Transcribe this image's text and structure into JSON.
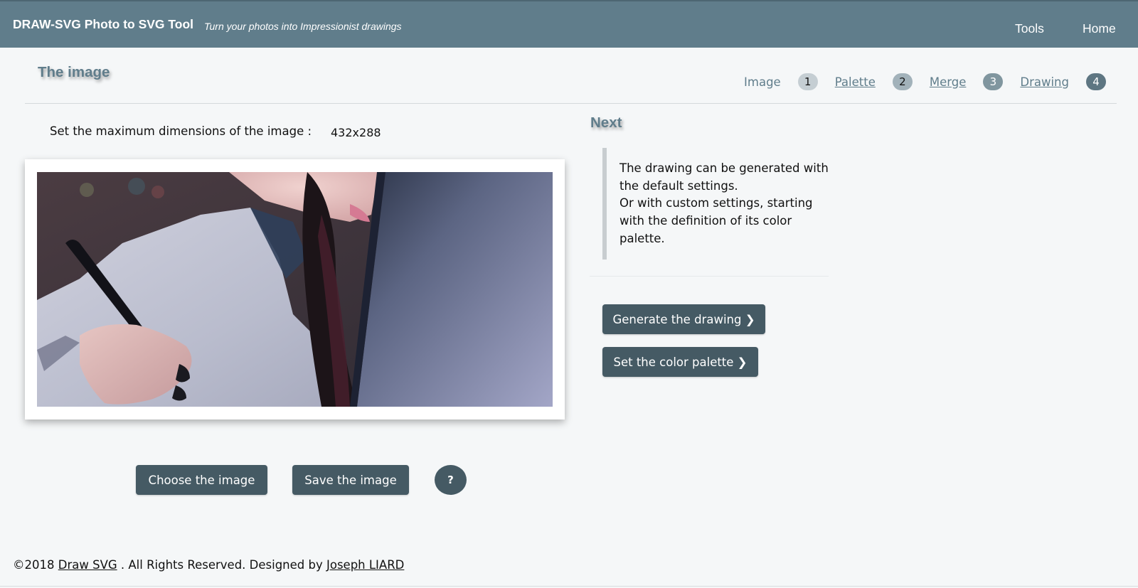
{
  "header": {
    "brand": "DRAW-SVG Photo to SVG Tool",
    "tagline": "Turn your photos into Impressionist drawings",
    "nav": [
      "Tools",
      "Home"
    ]
  },
  "image_section": {
    "title": "The image",
    "dimensions_label": "Set the maximum dimensions of the image :",
    "dimensions_value": "432x288",
    "photo_alt": "Photo of a woman drawing on a tablet with a stylus",
    "buttons": {
      "choose": "Choose the image",
      "save": "Save the image",
      "help": "?"
    }
  },
  "steps": [
    {
      "label": "Image",
      "number": "1",
      "badge_color": "#c5ced3",
      "number_color": "#111111"
    },
    {
      "label": "Palette",
      "number": "2",
      "badge_color": "#a2b2ba",
      "number_color": "#111111"
    },
    {
      "label": "Merge",
      "number": "3",
      "badge_color": "#80969f",
      "number_color": "#ffffff"
    },
    {
      "label": "Drawing",
      "number": "4",
      "badge_color": "#5e7682",
      "number_color": "#ffffff"
    }
  ],
  "next_section": {
    "title": "Next",
    "note_line1": "The drawing can be generated with the default settings.",
    "note_line2": "Or with custom settings, starting with the definition of its color palette.",
    "generate_button": "Generate the drawing ❯",
    "palette_button": "Set the color palette ❯"
  },
  "footer": {
    "prefix": "©2018",
    "site_link": "Draw SVG",
    "middle": ". All Rights Reserved. Designed by",
    "author_link": "Joseph LIARD"
  },
  "colors": {
    "header_bg": "#607d8b",
    "button_bg": "#455a64",
    "accent": "#607d8b",
    "page_bg": "#f5f7f8"
  }
}
